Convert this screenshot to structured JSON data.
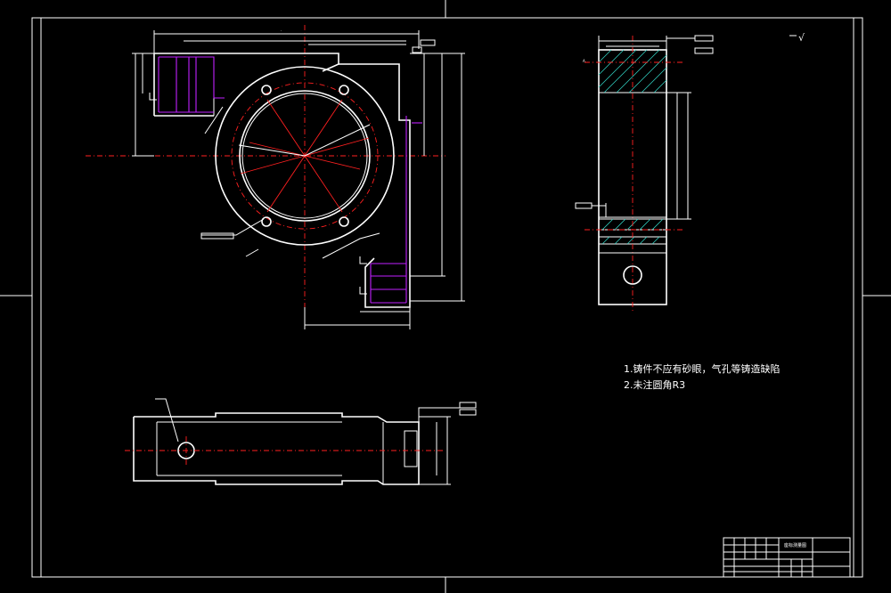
{
  "notes": {
    "line1": "1.铸件不应有砂眼，气孔等铸造缺陷",
    "line2": "2.未注圆角R3"
  },
  "roughness_symbol": "√",
  "title_block": {
    "drawing_name": "座标测量图"
  },
  "colors": {
    "background": "#000000",
    "outline": "#ffffff",
    "centerline": "#ff2020",
    "hidden": "#c020ff",
    "hatch": "#30d0c0"
  }
}
